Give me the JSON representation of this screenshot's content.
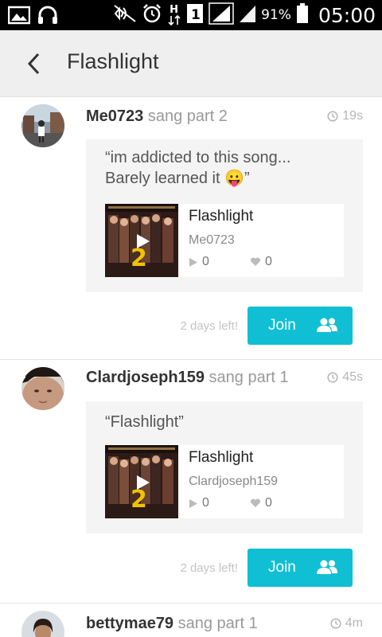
{
  "status_bar": {
    "battery": "91%",
    "time": "05:00",
    "network_label": "H"
  },
  "header": {
    "title": "Flashlight"
  },
  "posts": [
    {
      "username": "Me0723",
      "action": "sang part 2",
      "time": "19s",
      "quote": "“im addicted to this song... Barely learned it 😛”",
      "song": {
        "title": "Flashlight",
        "artist": "Me0723",
        "plays": "0",
        "likes": "0"
      },
      "deadline": "2 days left!",
      "join_label": "Join"
    },
    {
      "username": "Clardjoseph159",
      "action": "sang part 1",
      "time": "45s",
      "quote": "“Flashlight”",
      "song": {
        "title": "Flashlight",
        "artist": "Clardjoseph159",
        "plays": "0",
        "likes": "0"
      },
      "deadline": "2 days left!",
      "join_label": "Join"
    },
    {
      "username": "bettymae79",
      "action": "sang part 1",
      "time": "4m"
    }
  ],
  "colors": {
    "accent": "#10bfd3",
    "header_bg": "#efefef",
    "card_bg": "#f4f4f4"
  }
}
